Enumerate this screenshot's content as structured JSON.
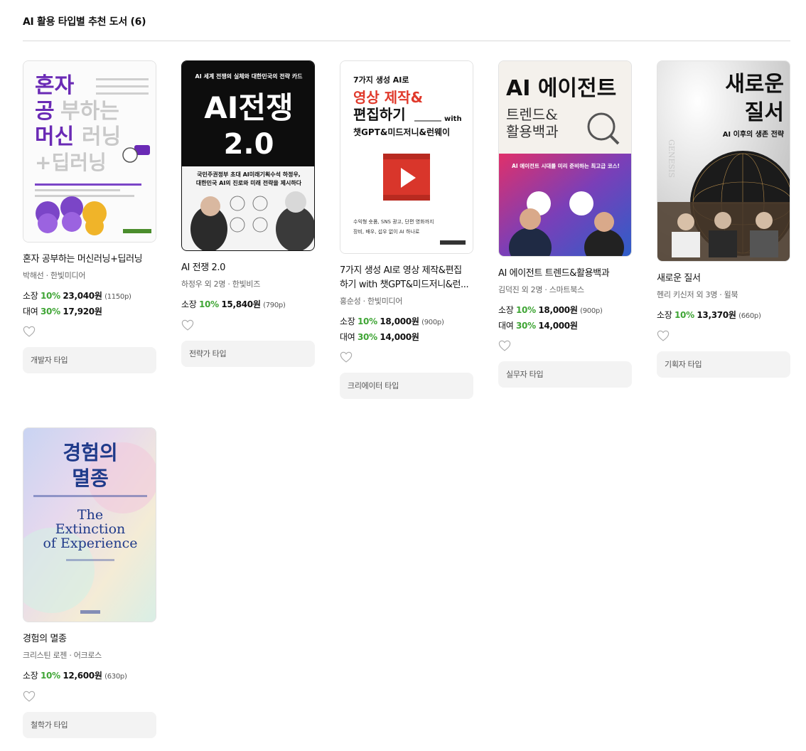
{
  "section": {
    "title": "AI 활용 타입별 추천 도서 (6)"
  },
  "labels": {
    "own": "소장",
    "rent": "대여"
  },
  "books": [
    {
      "title": "혼자 공부하는 머신러닝+딥러닝",
      "meta": "박해선 · 한빛미디어",
      "own": {
        "discount": "10%",
        "price": "23,040원",
        "points": "(1150p)"
      },
      "rent": {
        "discount": "30%",
        "price": "17,920원"
      },
      "type": "개발자 타입",
      "cover_text": [
        "혼자",
        "공부하는",
        "머신러닝",
        "+딥러닝"
      ]
    },
    {
      "title": "AI 전쟁 2.0",
      "meta": "하정우 외 2명 · 한빛비즈",
      "own": {
        "discount": "10%",
        "price": "15,840원",
        "points": "(790p)"
      },
      "type": "전략가 타입",
      "cover_text": [
        "AI 세계 전쟁의 실체와 대한민국의 전략 카드",
        "AI전쟁",
        "2.0",
        "국민주권정부 초대 AI미래기획수석 하정우,",
        "대한민국 AI의 진로와 미래 전략을 제시하다"
      ]
    },
    {
      "title": "7가지 생성 AI로 영상 제작&편집하기 with 챗GPT&미드저니&런...",
      "title_lines": [
        "7가지 생성 AI로 영상 제작&편집",
        "하기 with 챗GPT&미드저니&런..."
      ],
      "meta": "홍순성 · 한빛미디어",
      "own": {
        "discount": "10%",
        "price": "18,000원",
        "points": "(900p)"
      },
      "rent": {
        "discount": "30%",
        "price": "14,000원"
      },
      "type": "크리에이터 타입",
      "cover_text": [
        "7가지 생성 AI로",
        "영상 제작&",
        "편집하기",
        "with",
        "챗GPT&미드저니&런웨이",
        "수익형 숏폼, SNS 광고, 단편 영화까지",
        "장비, 배우, 섭우 없이 AI 하나로"
      ]
    },
    {
      "title": "AI 에이전트 트렌드&활용백과",
      "meta": "김덕진 외 2명 · 스마트북스",
      "own": {
        "discount": "10%",
        "price": "18,000원",
        "points": "(900p)"
      },
      "rent": {
        "discount": "30%",
        "price": "14,000원"
      },
      "type": "실무자 타입",
      "cover_text": [
        "AI 에이전트",
        "트렌드&",
        "활용백과",
        "AI 에이전트 시대를 미리 준비하는 최고급 코스!"
      ]
    },
    {
      "title": "새로운 질서",
      "meta": "헨리 키신저 외 3명 · 윌북",
      "own": {
        "discount": "10%",
        "price": "13,370원",
        "points": "(660p)"
      },
      "type": "기획자 타입",
      "cover_text": [
        "새로운",
        "질서",
        "AI 이후의 생존 전략",
        "GENESIS"
      ]
    },
    {
      "title": "경험의 멸종",
      "meta": "크리스틴 로젠 · 어크로스",
      "own": {
        "discount": "10%",
        "price": "12,600원",
        "points": "(630p)"
      },
      "type": "철학가 타입",
      "cover_text": [
        "경험의",
        "멸종",
        "The",
        "Extinction",
        "of Experience"
      ]
    }
  ],
  "colors": {
    "discount": "#3fa535",
    "type_button_bg": "#f3f3f3"
  },
  "icons": {
    "wishlist": "heart-outline-icon"
  }
}
